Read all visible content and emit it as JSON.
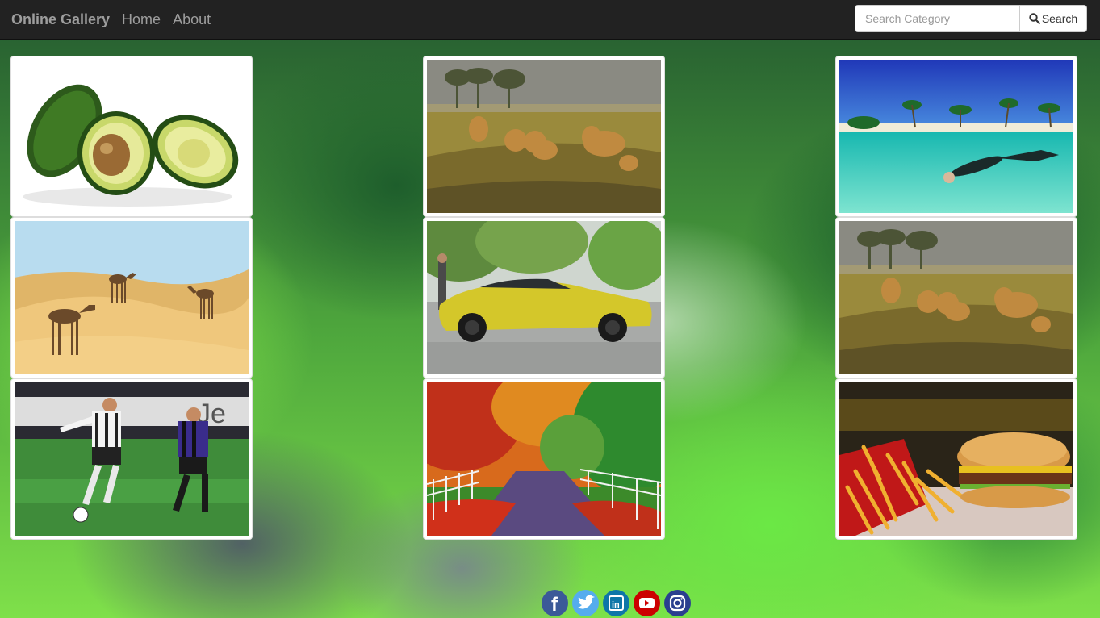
{
  "navbar": {
    "brand": "Online Gallery",
    "links": [
      "Home",
      "About"
    ],
    "search": {
      "placeholder": "Search Category",
      "button_label": "Search"
    }
  },
  "gallery": {
    "images": [
      {
        "subject": "avocado"
      },
      {
        "subject": "lions"
      },
      {
        "subject": "snorkeler"
      },
      {
        "subject": "camels"
      },
      {
        "subject": "sports-car"
      },
      {
        "subject": "lions"
      },
      {
        "subject": "football"
      },
      {
        "subject": "autumn-road"
      },
      {
        "subject": "burger-fries"
      }
    ]
  },
  "social": [
    "facebook",
    "twitter",
    "linkedin",
    "youtube",
    "instagram"
  ],
  "colors": {
    "navbar_bg": "#222222",
    "facebook": "#3b5998",
    "twitter": "#55acee",
    "linkedin": "#0e76a8",
    "youtube": "#cc0000",
    "instagram": "#2a3f8f"
  }
}
